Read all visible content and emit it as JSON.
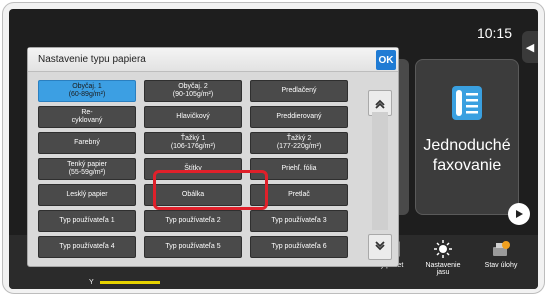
{
  "status": {
    "time": "10:15"
  },
  "home": {
    "fax_tile_label": "Jednoduché faxovanie",
    "bottom": {
      "copy_count": "ý počet",
      "brightness": "Nastavenie jasu",
      "job_status": "Stav úlohy",
      "toner_label": "Y"
    }
  },
  "dialog": {
    "title": "Nastavenie typu papiera",
    "ok_label": "OK",
    "options": [
      {
        "label": "Obyčaj. 1\n(60-89g/m²)",
        "selected": true
      },
      {
        "label": "Obyčaj. 2\n(90-105g/m²)",
        "selected": false
      },
      {
        "label": "Predlačený",
        "selected": false
      },
      {
        "label": "Re-\ncyklovaný",
        "selected": false
      },
      {
        "label": "Hlavičkový",
        "selected": false
      },
      {
        "label": "Preddierovaný",
        "selected": false
      },
      {
        "label": "Farebný",
        "selected": false
      },
      {
        "label": "Ťažký 1\n(106-176g/m²)",
        "selected": false
      },
      {
        "label": "Ťažký 2\n(177-220g/m²)",
        "selected": false
      },
      {
        "label": "Tenký papier\n(55-59g/m²)",
        "selected": false
      },
      {
        "label": "Štítky",
        "selected": false
      },
      {
        "label": "Priehľ. fólia",
        "selected": false
      },
      {
        "label": "Lesklý papier",
        "selected": false
      },
      {
        "label": "Obálka",
        "selected": false
      },
      {
        "label": "Pretlač",
        "selected": false
      },
      {
        "label": "Typ používateľa 1",
        "selected": false
      },
      {
        "label": "Typ používateľa 2",
        "selected": false
      },
      {
        "label": "Typ používateľa 3",
        "selected": false
      },
      {
        "label": "Typ používateľa 4",
        "selected": false
      },
      {
        "label": "Typ používateľa 5",
        "selected": false
      },
      {
        "label": "Typ používateľa 6",
        "selected": false
      }
    ],
    "highlighted_option": "Ťažký 1\n(106-176g/m²)"
  },
  "colors": {
    "selected": "#3c9fe3",
    "highlight": "#e0202a",
    "ok": "#1f7bd4"
  }
}
